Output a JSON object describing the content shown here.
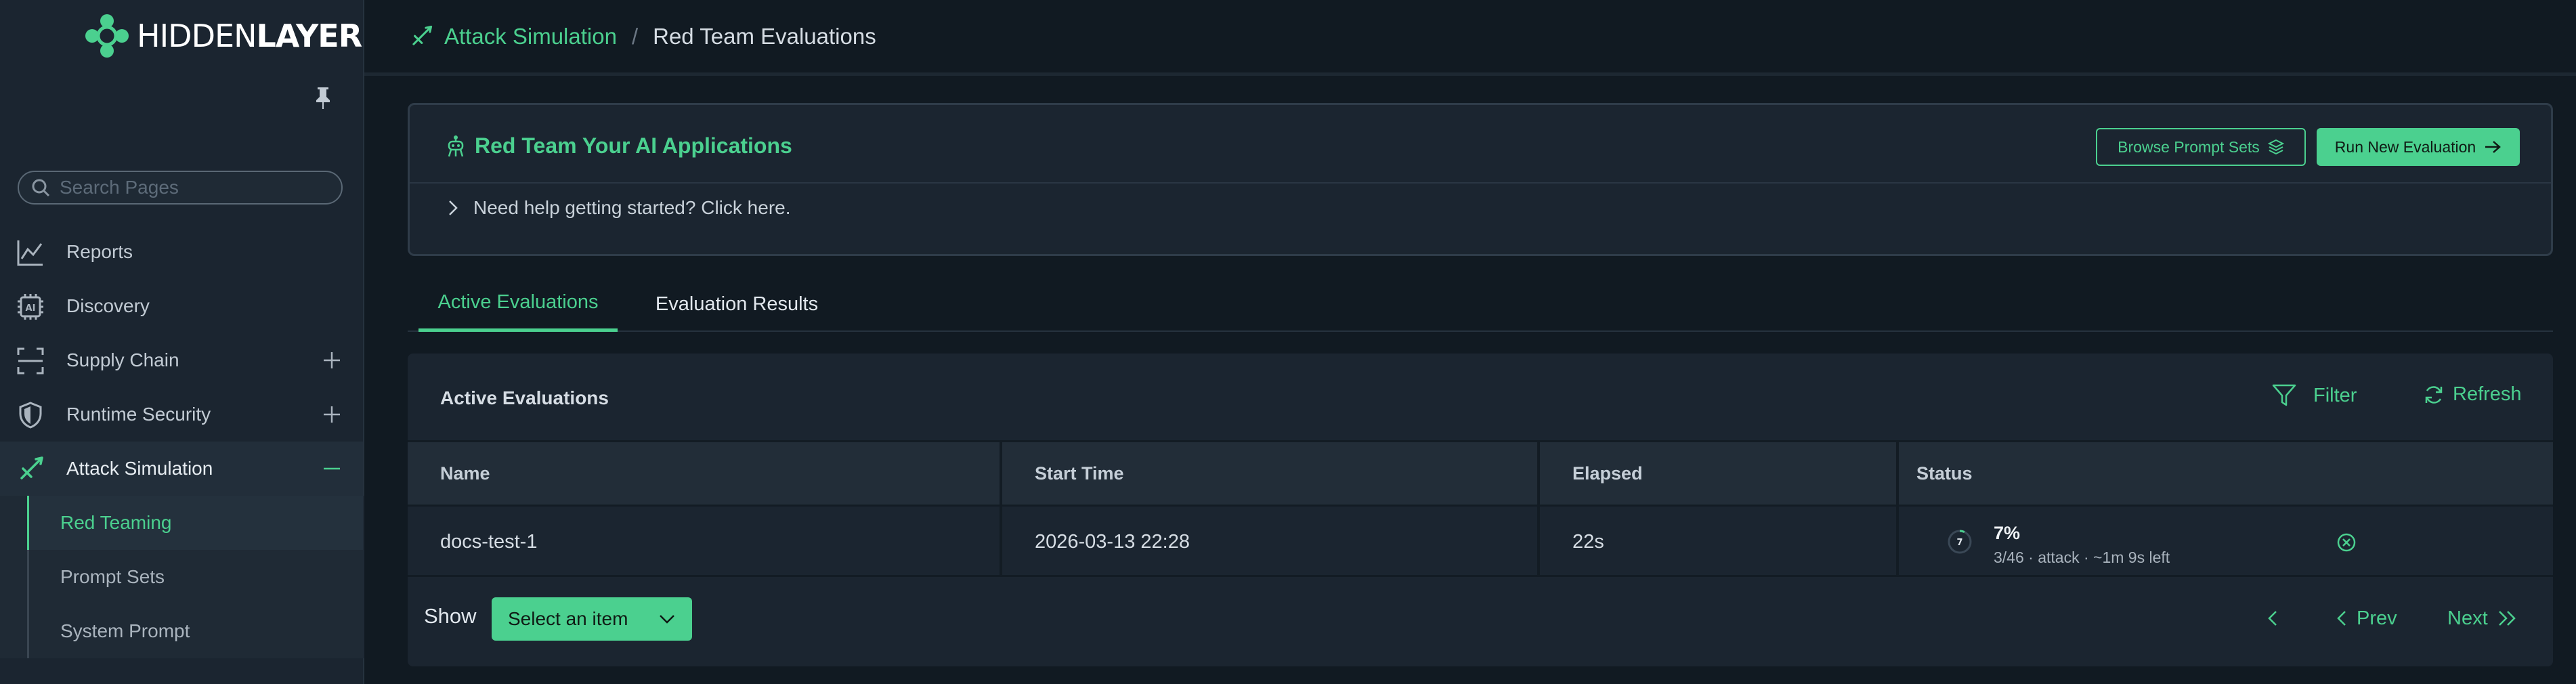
{
  "app": {
    "brand_prefix": "HIDDEN",
    "brand_suffix": "LAYER"
  },
  "sidebar": {
    "search_placeholder": "Search Pages",
    "items": [
      {
        "label": "Reports",
        "icon": "chart-line-icon"
      },
      {
        "label": "Discovery",
        "icon": "ai-chip-icon"
      },
      {
        "label": "Supply Chain",
        "icon": "scan-frame-icon",
        "toggle": "plus"
      },
      {
        "label": "Runtime Security",
        "icon": "shield-icon",
        "toggle": "plus"
      },
      {
        "label": "Attack Simulation",
        "icon": "sword-icon",
        "toggle": "minus",
        "active": true
      }
    ],
    "sub_items": [
      {
        "label": "Red Teaming",
        "selected": true
      },
      {
        "label": "Prompt Sets"
      },
      {
        "label": "System Prompt"
      }
    ]
  },
  "breadcrumb": {
    "parent": "Attack Simulation",
    "separator": "/",
    "current": "Red Team Evaluations"
  },
  "banner": {
    "title": "Red Team Your AI Applications",
    "browse_label": "Browse Prompt Sets",
    "run_label": "Run New Evaluation",
    "help_text": "Need help getting started? Click here."
  },
  "tabs": [
    {
      "label": "Active Evaluations",
      "active": true
    },
    {
      "label": "Evaluation Results"
    }
  ],
  "table": {
    "title": "Active Evaluations",
    "filter_label": "Filter",
    "refresh_label": "Refresh",
    "columns": [
      "Name",
      "Start Time",
      "Elapsed",
      "Status"
    ],
    "rows": [
      {
        "name": "docs-test-1",
        "start_time": "2026-03-13 22:28",
        "elapsed": "22s",
        "spinner_value": "7",
        "progress": "7%",
        "progress_fraction": 0.07,
        "detail": "3/46 · attack · ~1m 9s left"
      }
    ],
    "show_label": "Show",
    "select_placeholder": "Select an item",
    "prev_label": "Prev",
    "next_label": "Next"
  },
  "colors": {
    "accent": "#4bd08f",
    "background": "#111a22",
    "sidebar": "#1b2530"
  }
}
